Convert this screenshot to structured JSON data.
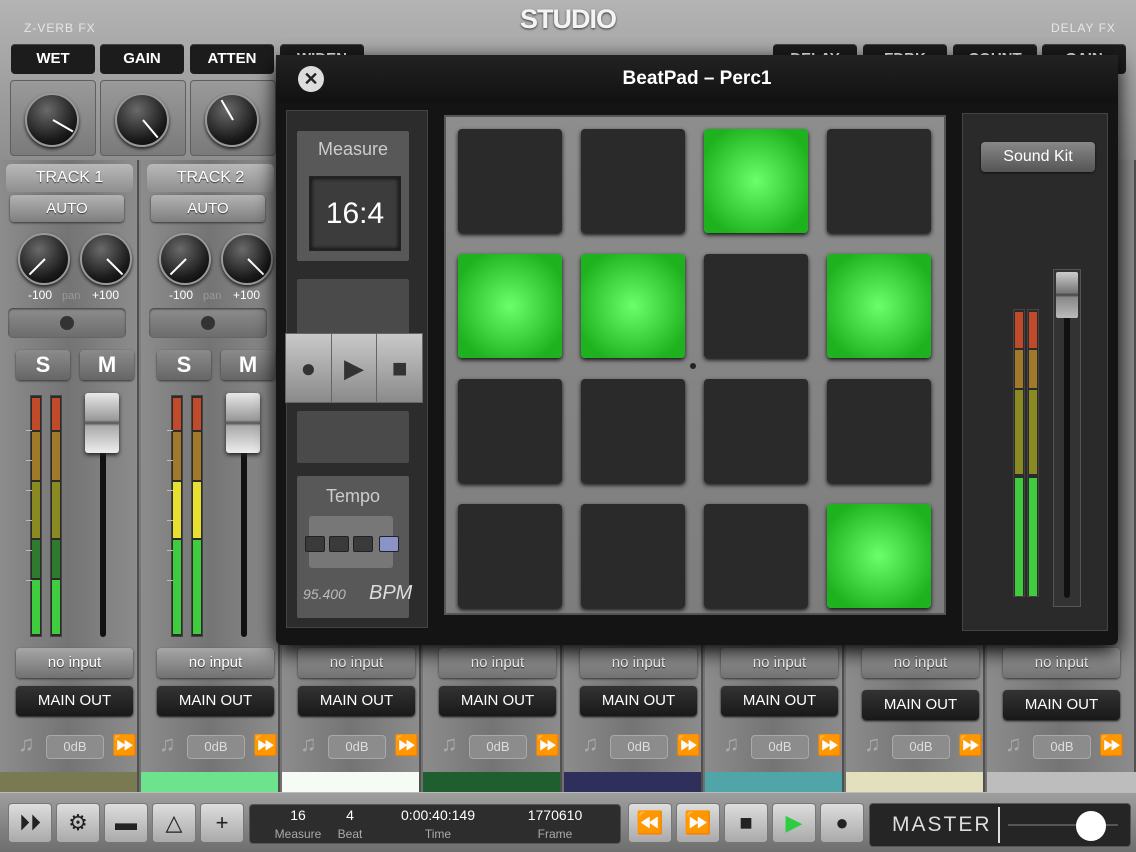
{
  "app": {
    "logo": "STUDIO",
    "fx_left_title": "Z-VERB FX",
    "fx_right_title": "DELAY FX",
    "fx_left_labels": [
      "WET",
      "GAIN",
      "ATTEN",
      "WIDEN"
    ],
    "fx_right_labels": [
      "DELAY",
      "FDBK",
      "COUNT",
      "GAIN"
    ]
  },
  "tracks": [
    {
      "name": "TRACK 1",
      "auto": "AUTO",
      "pan_min": "-100",
      "pan_label": "pan",
      "pan_max": "+100",
      "solo": "S",
      "mute": "M",
      "input": "no input",
      "output": "MAIN OUT",
      "level": "0dB",
      "color": "#7a7a52"
    },
    {
      "name": "TRACK 2",
      "auto": "AUTO",
      "pan_min": "-100",
      "pan_label": "pan",
      "pan_max": "+100",
      "solo": "S",
      "mute": "M",
      "input": "no input",
      "output": "MAIN OUT",
      "level": "0dB",
      "color": "#6ee38e"
    },
    {
      "input": "no input",
      "output": "MAIN OUT",
      "level": "0dB",
      "color": "#f6fbf6"
    },
    {
      "input": "no input",
      "output": "MAIN OUT",
      "level": "0dB",
      "color": "#1f5f2f"
    },
    {
      "input": "no input",
      "output": "MAIN OUT",
      "level": "0dB",
      "color": "#2f2f5c"
    },
    {
      "input": "no input",
      "output": "MAIN OUT",
      "level": "0dB",
      "color": "#4fa5a7"
    },
    {
      "input": "no input",
      "output": "MAIN OUT",
      "level": "0dB",
      "color": "#e2e0bd"
    },
    {
      "input": "no input",
      "output": "MAIN OUT",
      "level": "0dB",
      "color": "#bdbdbd"
    }
  ],
  "transport": {
    "measure_value": "16",
    "measure_label": "Measure",
    "beat_value": "4",
    "beat_label": "Beat",
    "time_value": "0:00:40:149",
    "time_label": "Time",
    "frame_value": "1770610",
    "frame_label": "Frame",
    "master_label": "MASTER",
    "master_level": 0.8
  },
  "beatpad": {
    "title": "BeatPad – Perc1",
    "measure_label": "Measure",
    "measure_value": "16:4",
    "tempo_label": "Tempo",
    "bpm_value": "95.400",
    "bpm_label": "BPM",
    "sound_kit": "Sound Kit",
    "pads": [
      false,
      false,
      true,
      false,
      true,
      true,
      false,
      true,
      false,
      false,
      false,
      false,
      false,
      false,
      false,
      true
    ]
  },
  "icons": {
    "close": "close-icon",
    "record": "record-icon",
    "play": "play-icon",
    "stop": "stop-icon",
    "note": "note-icon",
    "forward": "fast-forward-icon"
  },
  "colors": {
    "pad_active": "#3cf03c",
    "pad_inactive": "#2a2a2a",
    "play_green": "#2ecc40"
  }
}
